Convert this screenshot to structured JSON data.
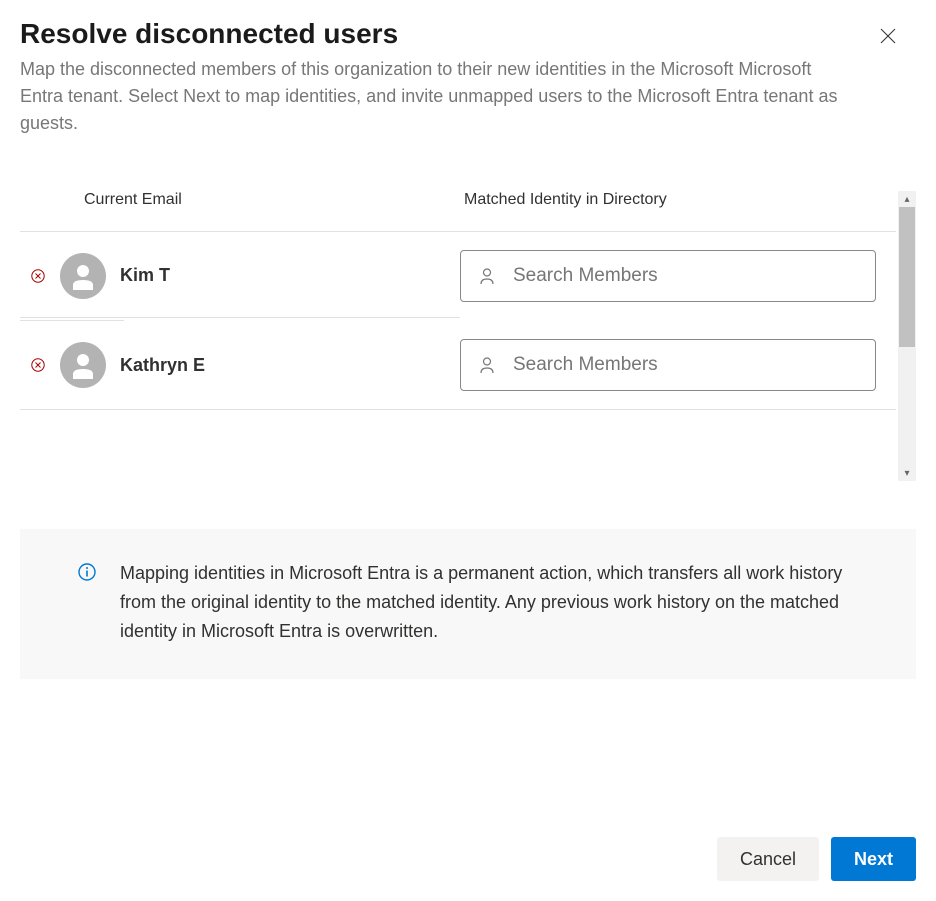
{
  "header": {
    "title": "Resolve disconnected users",
    "subtitle": "Map the disconnected members of this organization to their new identities in the Microsoft Microsoft Entra tenant. Select Next to map identities, and invite unmapped users to the Microsoft Entra tenant as guests."
  },
  "table": {
    "columns": {
      "email": "Current Email",
      "matched": "Matched Identity in Directory"
    },
    "search_placeholder": "Search Members",
    "rows": [
      {
        "name": "Kim T"
      },
      {
        "name": "Kathryn E"
      }
    ]
  },
  "info": {
    "text": "Mapping identities in Microsoft Entra is a permanent action, which transfers all work history from the original identity to the matched identity. Any previous work history on the matched identity in Microsoft Entra is overwritten."
  },
  "footer": {
    "cancel": "Cancel",
    "next": "Next"
  }
}
